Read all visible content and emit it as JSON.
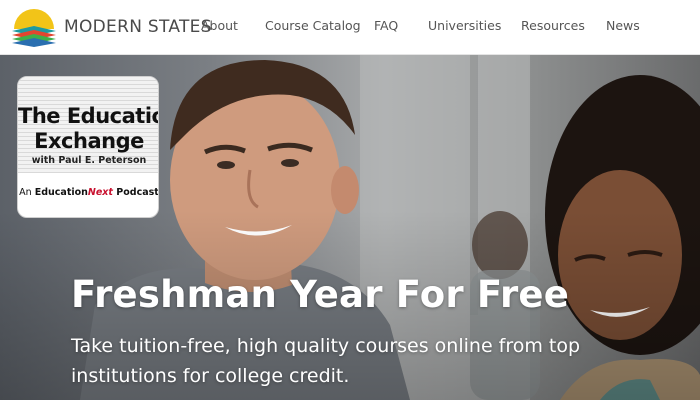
{
  "header": {
    "logo_text": "MODERN STATES",
    "logo_icon": "stacked-books-sunrise-icon",
    "nav": [
      {
        "label": "About"
      },
      {
        "label": "Course Catalog"
      },
      {
        "label": "FAQ"
      },
      {
        "label": "Universities"
      },
      {
        "label": "Resources"
      },
      {
        "label": "News"
      }
    ]
  },
  "podcast": {
    "title_line1": "The Education",
    "title_line2": "Exchange",
    "host": "with Paul E. Peterson",
    "footer_prefix": "An ",
    "footer_brand_a": "Education",
    "footer_brand_b": "Next",
    "footer_suffix": " Podcast"
  },
  "hero": {
    "title": "Freshman Year For Free",
    "subtitle": "Take tuition-free, high quality courses online from top institutions for college credit."
  },
  "colors": {
    "brand_yellow": "#f2c418",
    "brand_teal": "#1e9aa0",
    "brand_red": "#e2452f",
    "brand_green": "#3fae49",
    "nav_text": "#555555",
    "education_next_red": "#c8102e"
  }
}
